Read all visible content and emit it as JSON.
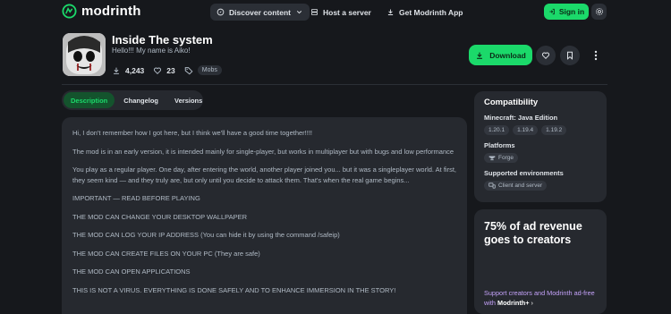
{
  "brand": {
    "name": "modrinth",
    "accent": "#1bd96a"
  },
  "nav": {
    "discover": "Discover content",
    "host": "Host a server",
    "app": "Get Modrinth App",
    "signin": "Sign in"
  },
  "project": {
    "title": "Inside The system",
    "summary": "Hello!!! My name is Aiko!",
    "downloads": "4,243",
    "follows": "23",
    "tag": "Mobs",
    "download_label": "Download"
  },
  "tabs": [
    "Description",
    "Changelog",
    "Versions"
  ],
  "description": [
    "Hi, I don't remember how I got here, but I think we'll have a good time together!!!!",
    "The mod is in an early version, it is intended mainly for single-player, but works in multiplayer but with bugs and low performance",
    "You play as a regular player. One day, after entering the world, another player joined you... but it was a singleplayer world. At first, they seem kind — and they truly are, but only until you decide to attack them. That's when the real game begins...",
    "IMPORTANT — READ BEFORE PLAYING",
    "THE MOD CAN CHANGE YOUR DESKTOP WALLPAPER",
    "THE MOD CAN LOG YOUR IP ADDRESS (You can hide it by using the command /safeip)",
    "THE MOD CAN CREATE FILES ON YOUR PC (They are safe)",
    "THE MOD CAN OPEN APPLICATIONS",
    "THIS IS NOT A VIRUS. EVERYTHING IS DONE SAFELY AND TO ENHANCE IMMERSION IN THE STORY!"
  ],
  "compatibility": {
    "title": "Compatibility",
    "minecraft_label": "Minecraft: Java Edition",
    "versions": [
      "1.20.1",
      "1.19.4",
      "1.19.2"
    ],
    "platforms_label": "Platforms",
    "platform": "Forge",
    "environments_label": "Supported environments",
    "environment": "Client and server"
  },
  "ad": {
    "title": "75% of ad revenue goes to creators",
    "body": "Support creators and Modrinth ad-free with",
    "plus": "Modrinth+"
  }
}
